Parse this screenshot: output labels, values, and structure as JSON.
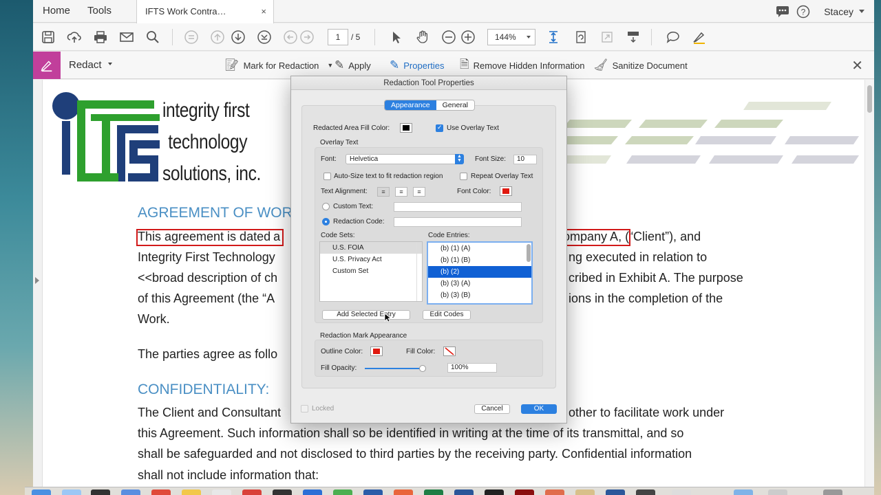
{
  "app": {
    "nav_home": "Home",
    "nav_tools": "Tools",
    "tab_title": "IFTS Work Contra…",
    "tab_close": "×",
    "user": "Stacey"
  },
  "toolbar": {
    "page_current": "1",
    "page_total": "/ 5",
    "zoom": "144%"
  },
  "redact_bar": {
    "title": "Redact",
    "mark": "Mark for Redaction",
    "apply": "Apply",
    "properties": "Properties",
    "remove_hidden": "Remove Hidden Information",
    "sanitize": "Sanitize Document",
    "close": "✕"
  },
  "document": {
    "logo_line1": "integrity first",
    "logo_line2": "technology",
    "logo_line3": "solutions, inc.",
    "heading1": "AGREEMENT OF WOR",
    "p1_l1_a": "This agreement is dated",
    "p1_l1_b": "a",
    "p1_l1_c": "ompany A",
    "p1_l1_d": ", (“Client”), and",
    "p1_l2_a": "Integrity First Technology",
    "p1_l2_b": "ng executed in relation to",
    "p1_l3_a": "<<broad description of ch",
    "p1_l3_b": "cribed in Exhibit A.  The purpose",
    "p1_l4_a": "of this Agreement (the “A",
    "p1_l4_b": "ions in the completion of the",
    "p1_l5": "Work.",
    "p2": "The parties agree as follo",
    "heading2": "CONFIDENTIALITY:",
    "p3_l1_a": "The Client and Consultant",
    "p3_l1_b": "other to facilitate work under",
    "p3_l2": "this Agreement.  Such information shall so be identified in writing at the time of its transmittal, and so",
    "p3_l3": "shall be safeguarded and not disclosed to third parties by the receiving party.  Confidential information",
    "p3_l4": "shall not include information that:"
  },
  "dialog": {
    "title": "Redaction Tool Properties",
    "tab_appearance": "Appearance",
    "tab_general": "General",
    "fill_color_label": "Redacted Area Fill Color:",
    "use_overlay_label": "Use Overlay Text",
    "overlay_group": "Overlay Text",
    "font_label": "Font:",
    "font_value": "Helvetica",
    "font_size_label": "Font Size:",
    "font_size_value": "10",
    "autosize_label": "Auto-Size text to fit redaction region",
    "repeat_label": "Repeat Overlay Text",
    "alignment_label": "Text Alignment:",
    "font_color_label": "Font Color:",
    "custom_text_label": "Custom Text:",
    "redaction_code_label": "Redaction Code:",
    "code_sets_label": "Code Sets:",
    "code_entries_label": "Code Entries:",
    "code_sets": [
      "U.S. FOIA",
      "U.S. Privacy Act",
      "Custom Set"
    ],
    "code_entries": [
      "(b) (1) (A)",
      "(b) (1) (B)",
      "(b) (2)",
      "(b) (3) (A)",
      "(b) (3) (B)"
    ],
    "add_entry": "Add Selected Entry",
    "edit_codes": "Edit Codes",
    "mark_group": "Redaction Mark Appearance",
    "outline_color_label": "Outline Color:",
    "fill_color2_label": "Fill Color:",
    "fill_opacity_label": "Fill Opacity:",
    "fill_opacity_value": "100%",
    "fill_opacity_level": 1.0,
    "locked_label": "Locked",
    "cancel": "Cancel",
    "ok": "OK"
  },
  "colors": {
    "accent": "#2c80e0",
    "redact_badge": "#c13f9b",
    "heading_blue": "#4a8fc4",
    "redaction_red": "#d21919",
    "fill_black": "#000000",
    "font_red": "#e0190f",
    "outline_red": "#e0190f"
  }
}
